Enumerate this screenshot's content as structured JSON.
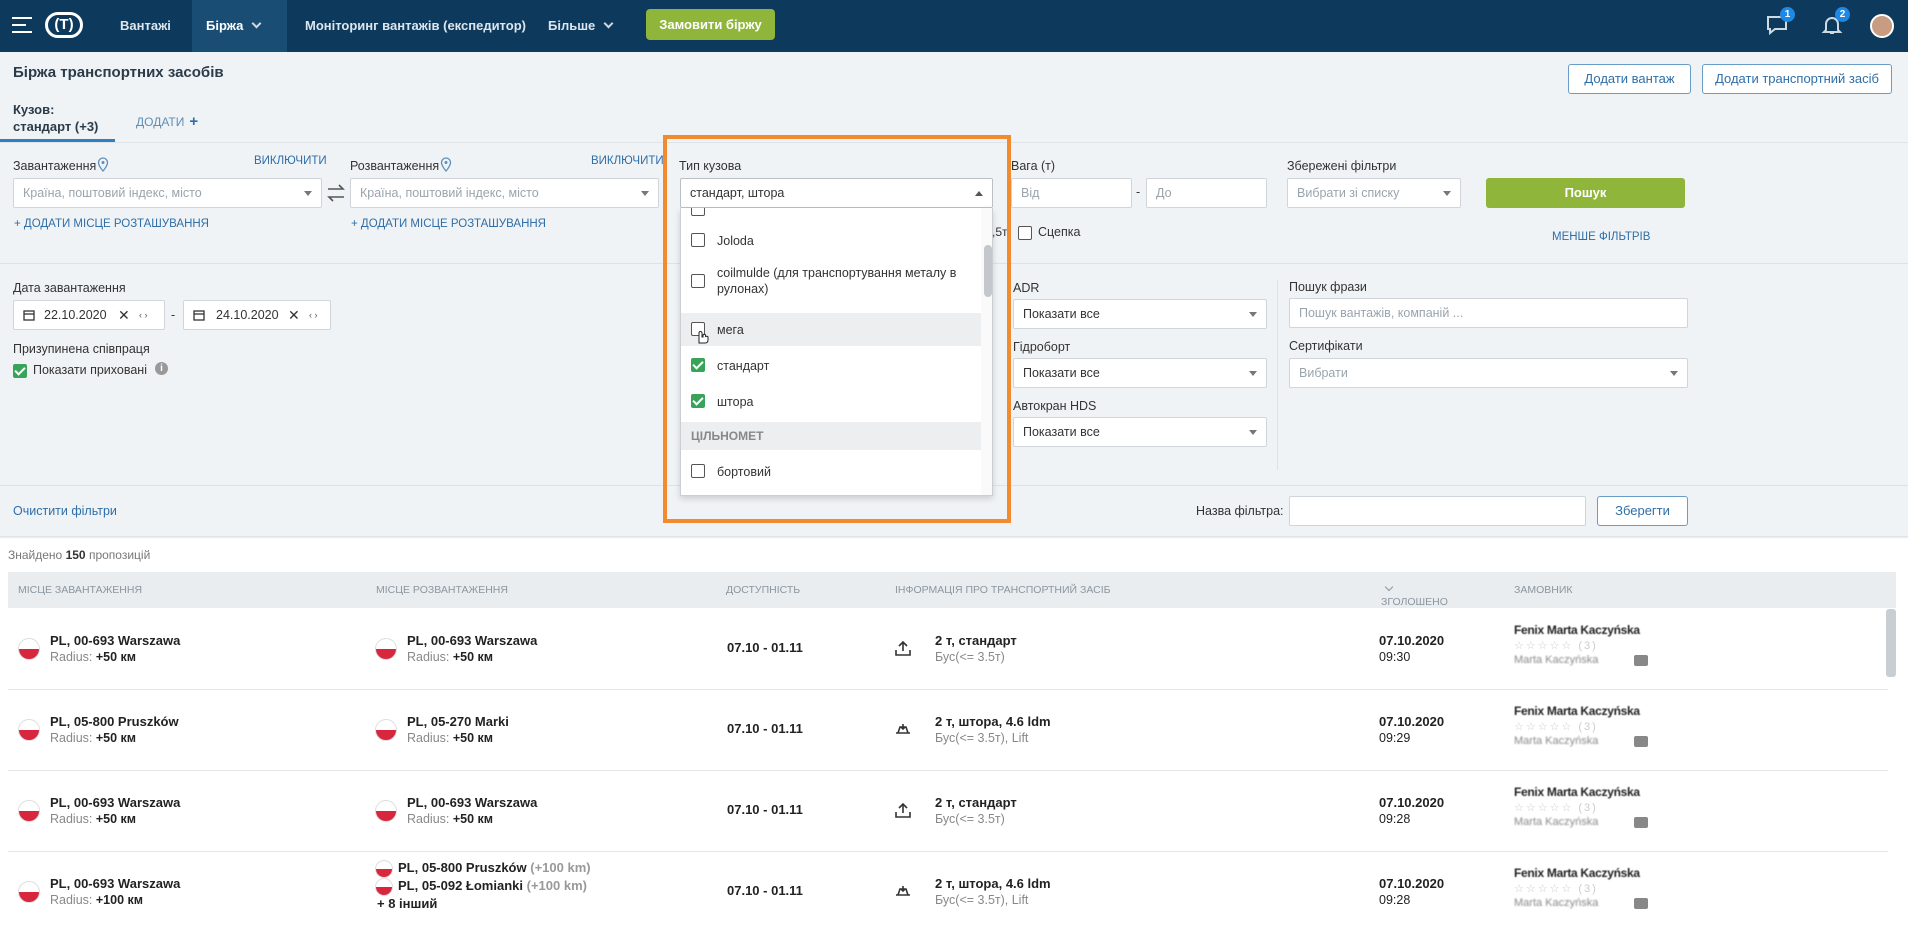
{
  "nav": {
    "items": [
      "Вантажі",
      "Біржа",
      "Моніторинг вантажів (експедитор)",
      "Більше"
    ],
    "logo": "(T)",
    "order_button": "Замовити біржу",
    "messages_badge": "1",
    "notifications_badge": "2"
  },
  "header": {
    "title": "Біржа транспортних засобів",
    "add_cargo": "Додати вантаж",
    "add_vehicle": "Додати транспортний засіб"
  },
  "tabs": {
    "kuzov_label": "Кузов:",
    "kuzov_value": "стандарт (+3)",
    "add_label": "ДОДАТИ",
    "add_plus": "+"
  },
  "filters": {
    "loading_label": "Завантаження",
    "unloading_label": "Розвантаження",
    "include": "ВИКЛЮЧИТИ",
    "location_placeholder": "Країна, поштовий індекс, місто",
    "add_location": "+ ДОДАТИ МІСЦЕ РОЗТАШУВАННЯ",
    "body_type_label": "Тип кузова",
    "body_type_value": "стандарт, штора",
    "weight_label": "Вага (т)",
    "weight_from": "Від",
    "weight_to": "До",
    "weight_dash": "-",
    "weight_frag": ",5т",
    "coupling": "Сцепка",
    "saved_label": "Збережені фільтри",
    "saved_placeholder": "Вибрати зі списку",
    "search": "Пошук",
    "less_filters": "МЕНШЕ ФІЛЬТРІВ",
    "load_date_label": "Дата завантаження",
    "date_from": "22.10.2020",
    "date_to": "24.10.2020",
    "date_dash": "-",
    "paused_label": "Призупинена співпраця",
    "show_hidden": "Показати приховані",
    "adr_label": "ADR",
    "show_all": "Показати все",
    "hydro_label": "Гідроборт",
    "crane_label": "Автокран HDS",
    "phrase_label": "Пошук фрази",
    "phrase_placeholder": "Пошук вантажів, компаній ...",
    "cert_label": "Сертифікати",
    "cert_placeholder": "Вибрати",
    "clear": "Очистити фільтри",
    "filter_name_label": "Назва фільтра:",
    "save": "Зберегти"
  },
  "dropdown": {
    "items": [
      {
        "label": "Joloda",
        "checked": false
      },
      {
        "label": "coilmulde (для транспортування металу в рулонах)",
        "checked": false
      },
      {
        "label": "мега",
        "checked": false
      },
      {
        "label": "стандарт",
        "checked": true
      },
      {
        "label": "штора",
        "checked": true
      }
    ],
    "group_label": "ЦІЛЬНОМЕТ",
    "after_group": "бортовий"
  },
  "results": {
    "found_prefix": "Знайдено",
    "found_count": "150",
    "found_suffix": "пропозицій",
    "columns": [
      "МІСЦЕ ЗАВАНТАЖЕННЯ",
      "МІСЦЕ РОЗВАНТАЖЕННЯ",
      "ДОСТУПНІСТЬ",
      "ІНФОРМАЦІЯ ПРО ТРАНСПОРТНИЙ ЗАСІБ",
      "ЗГОЛОШЕНО",
      "ЗАМОВНИК"
    ],
    "radius_label": "Radius:",
    "rows": [
      {
        "from": "PL, 00-693 Warszawa",
        "from_radius": "+50 км",
        "to": "PL, 00-693 Warszawa",
        "to_radius": "+50 км",
        "avail": "07.10 - 01.11",
        "vehicle": "2 т, стандарт",
        "vehicle_sub": "Бус(<= 3.5т)",
        "date": "07.10.2020",
        "time": "09:30",
        "customer": "Fenix Marta Kaczyńska",
        "customer_sub": "Marta Kaczyńska",
        "rating": "(3)"
      },
      {
        "from": "PL, 05-800 Pruszków",
        "from_radius": "+50 км",
        "to": "PL, 05-270 Marki",
        "to_radius": "+50 км",
        "avail": "07.10 - 01.11",
        "vehicle": "2 т, штора, 4.6 ldm",
        "vehicle_sub": "Бус(<= 3.5т), Lift",
        "date": "07.10.2020",
        "time": "09:29",
        "customer": "Fenix Marta Kaczyńska",
        "customer_sub": "Marta Kaczyńska",
        "rating": "(3)"
      },
      {
        "from": "PL, 00-693 Warszawa",
        "from_radius": "+50 км",
        "to": "PL, 00-693 Warszawa",
        "to_radius": "+50 км",
        "avail": "07.10 - 01.11",
        "vehicle": "2 т, стандарт",
        "vehicle_sub": "Бус(<= 3.5т)",
        "date": "07.10.2020",
        "time": "09:28",
        "customer": "Fenix Marta Kaczyńska",
        "customer_sub": "Marta Kaczyńska",
        "rating": "(3)"
      },
      {
        "from": "PL, 00-693 Warszawa",
        "from_radius": "+100 км",
        "to": "PL, 05-800 Pruszków",
        "to_extra": "(+100 km)",
        "to2": "PL, 05-092 Łomianki",
        "to2_extra": "(+100 km)",
        "to_more": "+ 8 інший",
        "avail": "07.10 - 01.11",
        "vehicle": "2 т, штора, 4.6 ldm",
        "vehicle_sub": "Бус(<= 3.5т), Lift",
        "date": "07.10.2020",
        "time": "09:28",
        "customer": "Fenix Marta Kaczyńska",
        "customer_sub": "Marta Kaczyńska",
        "rating": "(3)"
      }
    ]
  },
  "colors": {
    "nav": "#0d3a5c",
    "accent_green": "#8fb63a",
    "link_blue": "#2f6ea7",
    "highlight": "#f28a2e"
  }
}
